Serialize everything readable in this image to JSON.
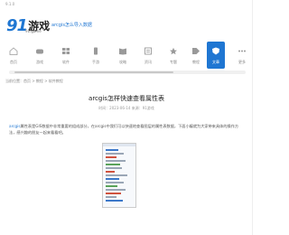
{
  "topbar": {
    "tiny_text": "9.1.0"
  },
  "logo": {
    "number": "91",
    "chars": "游戏",
    "sub": "91.game"
  },
  "tagline": "arcgis怎么导入数据",
  "nav": {
    "items": [
      {
        "label": "首页"
      },
      {
        "label": "游戏"
      },
      {
        "label": "软件"
      },
      {
        "label": "手游"
      },
      {
        "label": "攻略"
      },
      {
        "label": "资讯"
      },
      {
        "label": "专题"
      },
      {
        "label": "教程"
      },
      {
        "label": "文章"
      },
      {
        "label": "更多"
      }
    ],
    "active_index": 8
  },
  "breadcrumb": "当前位置：首页 > 教程 > 软件教程",
  "article": {
    "title": "arcgis怎样快速查看属性表",
    "meta": "时间：2023-06-14  来源：91游戏",
    "paragraph_highlight": "arcgis",
    "paragraph": "属性表是GIS数据中非常重要的组成部分，在arcgis中我们可以快速地查看图层的属性表数据，下面小编就为大家带来具体的操作方法，感兴趣的朋友一起来看看吧。"
  },
  "colors": {
    "accent": "#1f76d2"
  }
}
